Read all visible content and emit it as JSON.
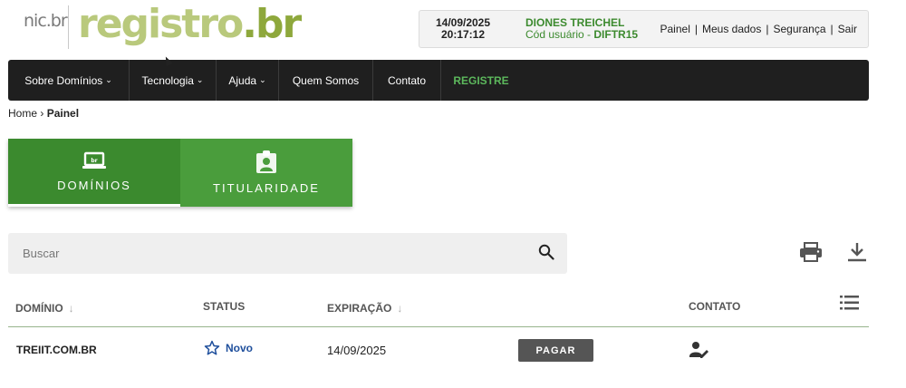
{
  "header": {
    "logo_nic": "nic.br",
    "logo_registro": "registro",
    "logo_br": ".br",
    "date": "14/09/2025",
    "time": "20:17:12",
    "user_name": "DIONES TREICHEL",
    "user_code_label": "Cód usuário - ",
    "user_code": "DIFTR15",
    "links": [
      "Painel",
      "Meus dados",
      "Segurança",
      "Sair"
    ]
  },
  "nav": {
    "items": [
      {
        "label": "Sobre Domínios",
        "dropdown": true
      },
      {
        "label": "Tecnologia",
        "dropdown": true
      },
      {
        "label": "Ajuda",
        "dropdown": true
      },
      {
        "label": "Quem Somos",
        "dropdown": false
      },
      {
        "label": "Contato",
        "dropdown": false
      },
      {
        "label": "REGISTRE",
        "dropdown": false
      }
    ],
    "chevron": "⌄"
  },
  "breadcrumb": {
    "home": "Home",
    "separator": "›",
    "current": "Painel"
  },
  "tabs": [
    {
      "label": "DOMÍNIOS",
      "icon": "laptop-icon",
      "active": true
    },
    {
      "label": "TITULARIDADE",
      "icon": "clipboard-user-icon",
      "active": false
    }
  ],
  "search": {
    "placeholder": "Buscar",
    "value": ""
  },
  "table": {
    "columns": {
      "domain": "DOMÍNIO",
      "status": "STATUS",
      "expiration": "EXPIRAÇÃO",
      "contact": "CONTATO"
    },
    "sort_arrow": "↓",
    "rows": [
      {
        "domain": "TREIIT.COM.BR",
        "status": "Novo",
        "expiration": "14/09/2025",
        "action": "PAGAR"
      }
    ]
  },
  "colors": {
    "brand_green": "#3b8a2e",
    "tab_green": "#4a9d3c",
    "nav_bg": "#1f1f1f",
    "status_blue": "#1f4f9c"
  }
}
